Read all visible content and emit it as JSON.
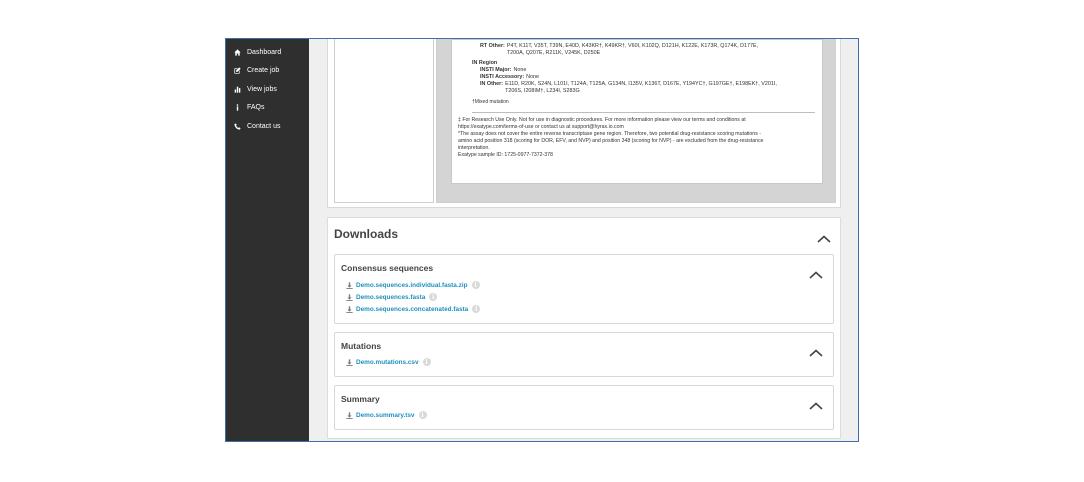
{
  "sidebar": {
    "items": [
      {
        "label": "Dashboard",
        "icon": "home-icon"
      },
      {
        "label": "Create job",
        "icon": "edit-icon"
      },
      {
        "label": "View jobs",
        "icon": "bar-chart-icon"
      },
      {
        "label": "FAQs",
        "icon": "info-icon"
      },
      {
        "label": "Contact us",
        "icon": "phone-icon"
      }
    ]
  },
  "report": {
    "rt_other_label": "RT Other:",
    "rt_other_line1": "P4T, K11T, V35T, T39N, E40D, K43KR†, K49KR†, V60I, K102Q, D121H, K122E, K173R, Q174K, D177E,",
    "rt_other_line2": "T200A, Q207E, R211K, V245K, D250E",
    "in_region": "IN Region",
    "insti_major_label": "INSTI Major:",
    "insti_major_value": "None",
    "insti_accessory_label": "INSTI Accessory:",
    "insti_accessory_value": "None",
    "in_other_label": "IN Other:",
    "in_other_line1": "E11D, R20K, S24N, L101I, T124A, T125A, G134N, I135V, K136T, D167E, Y194YC†, G197GE†, E198EK†, V201I,",
    "in_other_line2": "T206S, I208IM†, L234I, S283G",
    "mixed_note": "†Mixed mutation",
    "footnote1": "‡ For Research Use Only. Not for use in diagnostic procedures. For more information please view our terms and conditions at",
    "footnote2": "https://exatype.com/terms-of-use or contact us at support@hyrax.io.com",
    "footnote3": "*The assay does not cover the entire reverse transcriptase gene region. Therefore, two potential drug-resistance scoring mutations -",
    "footnote4": "amino acid position 318 (scoring for DOR, EFV, and NVP) and position 348 (scoring for NVP) - are excluded from the drug-resistance",
    "footnote5": "interpretation.",
    "sample_id": "Exatype sample ID: 1725-0977-7372-378"
  },
  "downloads": {
    "title": "Downloads",
    "sections": [
      {
        "title": "Consensus sequences",
        "files": [
          "Demo.sequences.individual.fasta.zip",
          "Demo.sequences.fasta",
          "Demo.sequences.concatenated.fasta"
        ]
      },
      {
        "title": "Mutations",
        "files": [
          "Demo.mutations.csv"
        ]
      },
      {
        "title": "Summary",
        "files": [
          "Demo.summary.tsv"
        ]
      }
    ]
  }
}
